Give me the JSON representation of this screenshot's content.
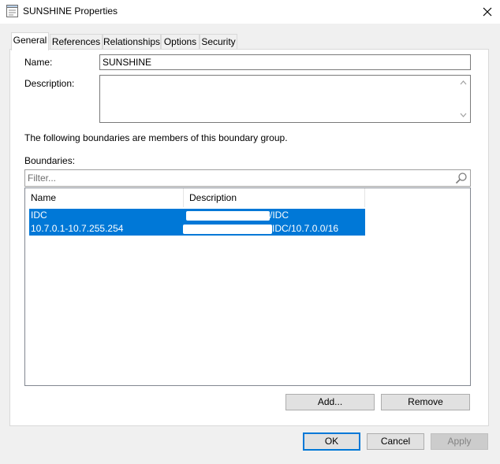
{
  "window": {
    "title": "SUNSHINE Properties"
  },
  "tabs": [
    {
      "label": "General",
      "active": true
    },
    {
      "label": "References",
      "active": false
    },
    {
      "label": "Relationships",
      "active": false
    },
    {
      "label": "Options",
      "active": false
    },
    {
      "label": "Security",
      "active": false
    }
  ],
  "general": {
    "name_label": "Name:",
    "name_value": "SUNSHINE",
    "description_label": "Description:",
    "description_value": "",
    "info_text": "The following boundaries are members of this boundary group.",
    "boundaries_label": "Boundaries:",
    "filter_placeholder": "Filter...",
    "columns": [
      "Name",
      "Description"
    ],
    "rows": [
      {
        "name": "IDC",
        "description": "/IDC",
        "selected": true
      },
      {
        "name": "10.7.0.1-10.7.255.254",
        "description": "IDC/10.7.0.0/16",
        "selected": true
      }
    ],
    "add_label": "Add...",
    "remove_label": "Remove"
  },
  "footer": {
    "ok_label": "OK",
    "cancel_label": "Cancel",
    "apply_label": "Apply"
  },
  "colors": {
    "accent": "#0078d7",
    "dialog_bg": "#f0f0f0"
  }
}
